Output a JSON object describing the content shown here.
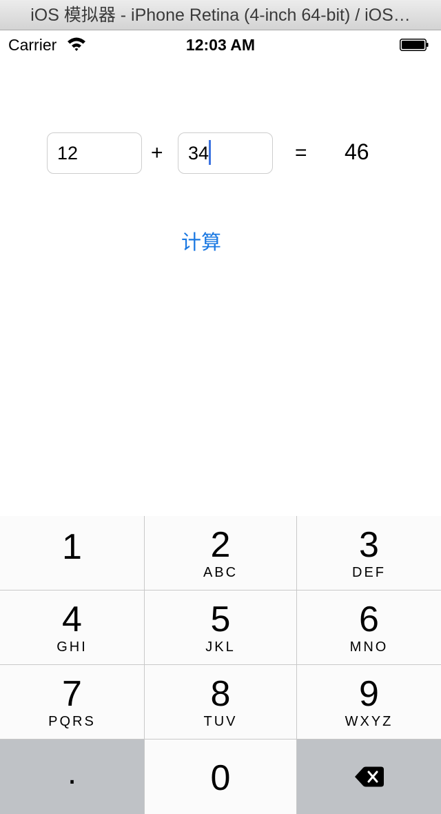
{
  "window": {
    "title": "iOS 模拟器 - iPhone Retina (4-inch 64-bit) / iOS…"
  },
  "status_bar": {
    "carrier": "Carrier",
    "time": "12:03 AM"
  },
  "calculator": {
    "operand_a": "12",
    "operand_b": "34",
    "plus_sign": "+",
    "equals_sign": "=",
    "result": "46",
    "compute_label": "计算"
  },
  "keypad": {
    "k1": {
      "digit": "1",
      "letters": ""
    },
    "k2": {
      "digit": "2",
      "letters": "ABC"
    },
    "k3": {
      "digit": "3",
      "letters": "DEF"
    },
    "k4": {
      "digit": "4",
      "letters": "GHI"
    },
    "k5": {
      "digit": "5",
      "letters": "JKL"
    },
    "k6": {
      "digit": "6",
      "letters": "MNO"
    },
    "k7": {
      "digit": "7",
      "letters": "PQRS"
    },
    "k8": {
      "digit": "8",
      "letters": "TUV"
    },
    "k9": {
      "digit": "9",
      "letters": "WXYZ"
    },
    "dot": ".",
    "k0": "0"
  },
  "icons": {
    "wifi": "wifi-icon",
    "battery": "battery-icon",
    "backspace": "backspace-icon"
  },
  "colors": {
    "accent": "#1a78e2",
    "caret": "#3c73e0",
    "key_bg": "#fbfbfb",
    "special_key_bg": "#bfc2c6"
  }
}
